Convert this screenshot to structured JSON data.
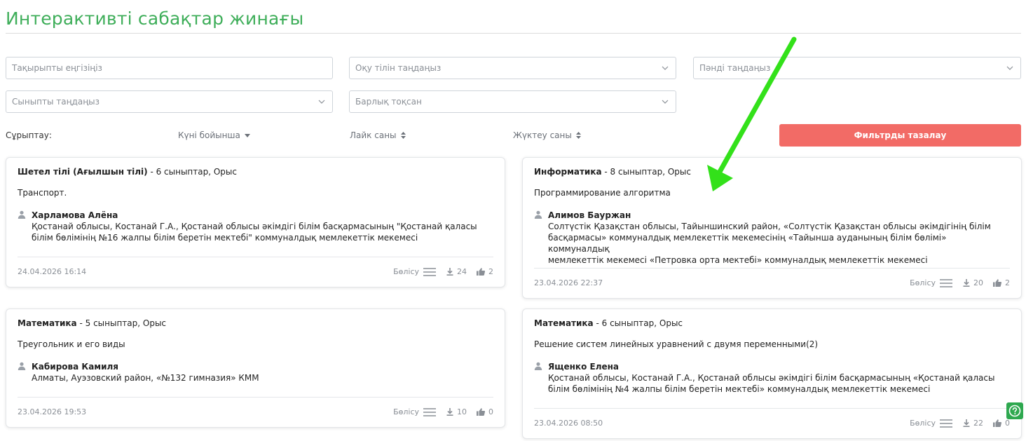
{
  "page": {
    "title": "Интерактивті сабақтар жинағы"
  },
  "filters": {
    "topic_placeholder": "Тақырыпты еңгізіңіз",
    "language_placeholder": "Оқу тілін таңдаңыз",
    "subject_placeholder": "Пәнді таңдаңыз",
    "class_placeholder": "Сыныпты таңдаңыз",
    "quarter_value": "Барлық тоқсан"
  },
  "sort": {
    "label": "Сұрыптау:",
    "by_date": "Күні бойынша",
    "by_likes": "Лайк саны",
    "by_downloads": "Жүктеу саны"
  },
  "clear_button": "Фильтрды тазалау",
  "cards": [
    {
      "subject": "Шетел тілі (Ағылшын тілі)",
      "meta": " - 6 сыныптар, Орыс",
      "topic": "Транспорт.",
      "author": "Харламова Алёна",
      "affiliation_lines": [
        "Қостанай облысы, Костанай Г.А., Қостанай облысы әкімдігі білім басқармасының \"Қостанай қаласы",
        "білім бөлімінің №16 жалпы білім беретін мектебі\" коммуналдық мемлекеттік мекемесі"
      ],
      "date": "24.04.2026 16:14",
      "share": "Бөлісу",
      "downloads": "24",
      "likes": "2"
    },
    {
      "subject": "Информатика",
      "meta": " - 8 сыныптар, Орыс",
      "topic": "Программирование алгоритма",
      "author": "Алимов Бауржан",
      "affiliation_lines": [
        "Солтүстік Қазақстан облысы, Тайыншинский район, «Солтүстік Қазақстан облысы әкімдігінің білім",
        "басқармасы» коммуналдық мемлекеттік мекемесінің «Тайынша ауданының білім бөлімі» коммуналдық",
        "мемлекеттік мекемесі «Петровка орта мектебі» коммуналдық мемлекеттік мекемесі"
      ],
      "date": "23.04.2026 22:37",
      "share": "Бөлісу",
      "downloads": "20",
      "likes": "2"
    },
    {
      "subject": "Математика",
      "meta": " - 5 сыныптар, Орыс",
      "topic": "Треугольник и его виды",
      "author": "Кабирова Камиля",
      "affiliation_lines": [
        "Алматы, Ауэзовский район, «№132 гимназия» КММ"
      ],
      "date": "23.04.2026 19:53",
      "share": "Бөлісу",
      "downloads": "10",
      "likes": "0"
    },
    {
      "subject": "Математика",
      "meta": " - 6 сыныптар, Орыс",
      "topic": "Решение систем линейных уравнений с двумя переменными(2)",
      "author": "Ященко Елена",
      "affiliation_lines": [
        "Қостанай облысы, Костанай Г.А., Қостанай облысы әкімдігі білім басқармасының «Қостанай қаласы",
        "білім бөлімінің №4 жалпы білім беретін мектебі» коммуналдық мемлекеттік мекемесі"
      ],
      "date": "23.04.2026 08:50",
      "share": "Бөлісу",
      "downloads": "22",
      "likes": "0"
    }
  ],
  "colors": {
    "title_green": "#3fae5a",
    "clear_button": "#f26b66",
    "help_button": "#2ea84f",
    "annotation_arrow": "#33e11a"
  },
  "icons": {
    "person": "person-icon",
    "download": "download-icon",
    "like": "thumbs-up-icon",
    "share": "hamburger-icon",
    "help": "help-icon",
    "chevron": "chevron-down-icon"
  }
}
